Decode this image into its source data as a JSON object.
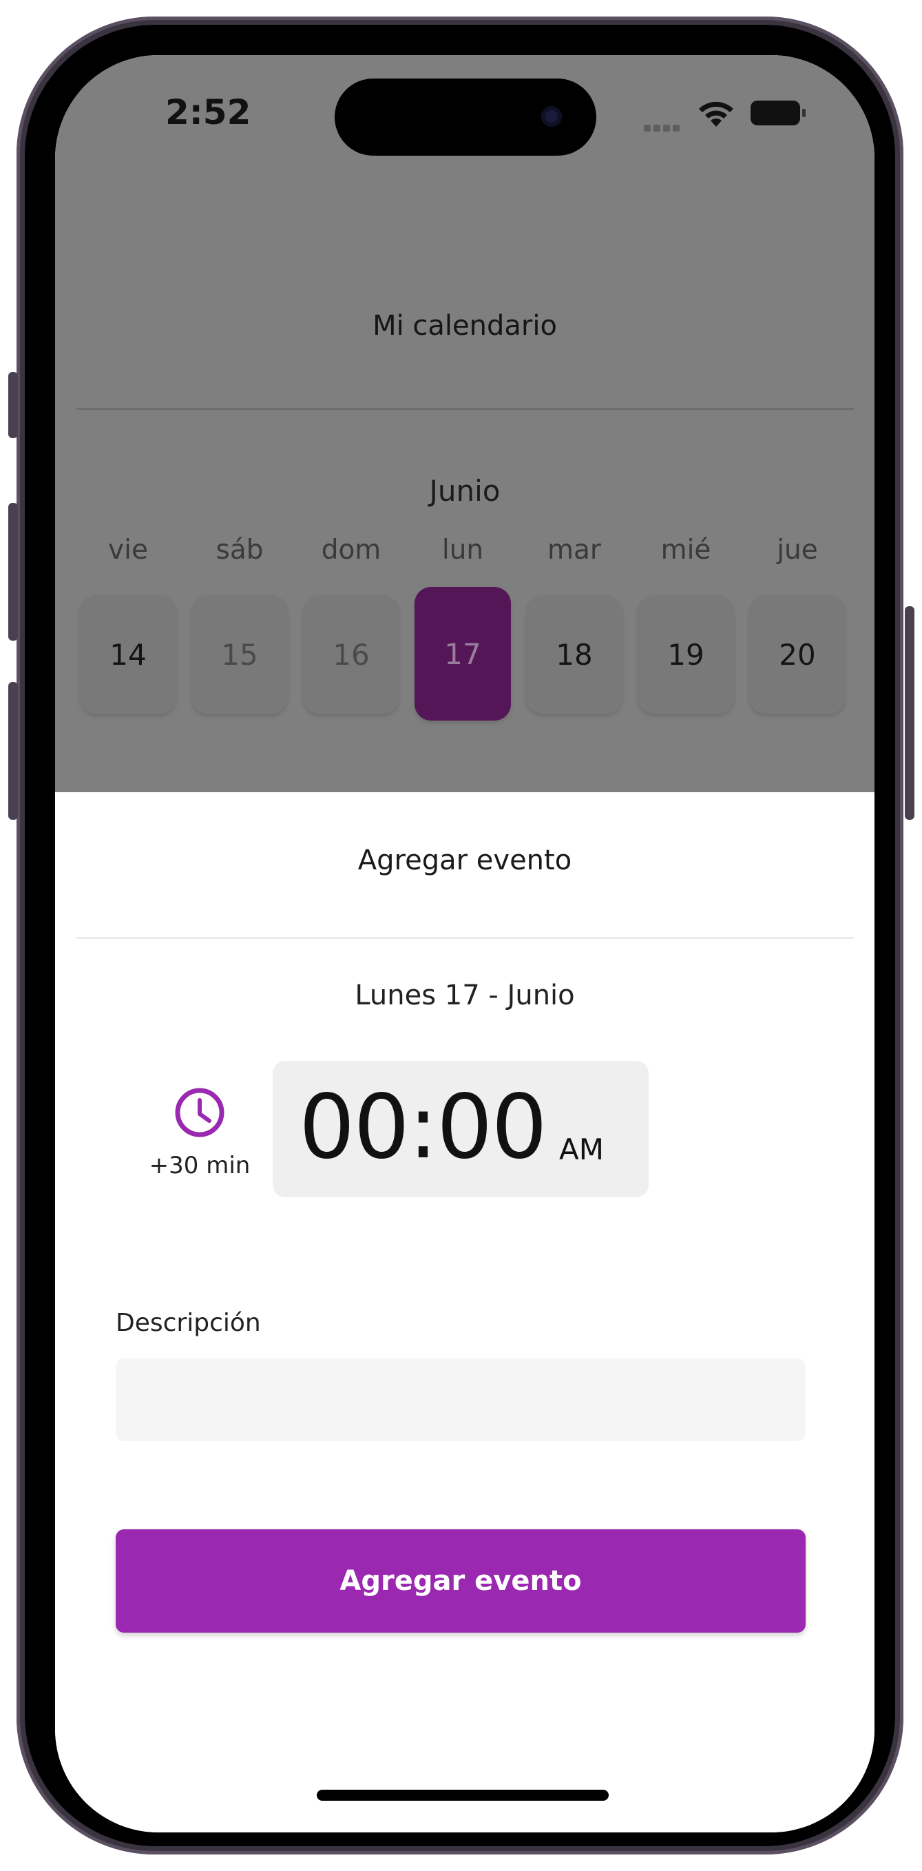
{
  "status_bar": {
    "time": "2:52"
  },
  "calendar": {
    "title": "Mi calendario",
    "month": "Junio",
    "weekdays": [
      "vie",
      "sáb",
      "dom",
      "lun",
      "mar",
      "mié",
      "jue"
    ],
    "days": [
      "14",
      "15",
      "16",
      "17",
      "18",
      "19",
      "20"
    ],
    "selected_day": "17"
  },
  "add_event": {
    "title": "Agregar evento",
    "date_label": "Lunes 17 - Junio",
    "duration_label": "+30 min",
    "time": "00:00",
    "period": "AM",
    "description_label": "Descripción",
    "description_value": "",
    "submit_label": "Agregar evento"
  },
  "colors": {
    "accent": "#9a28b0",
    "selected_day": "#541657",
    "overlay": "#7f7f7f"
  }
}
